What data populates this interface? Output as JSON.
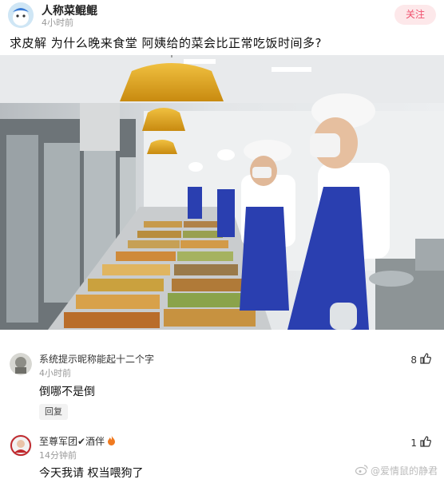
{
  "post": {
    "author": "人称菜鲲鲲",
    "time": "4小时前",
    "follow_label": "关注",
    "title": "求皮解 为什么晚来食堂 阿姨给的菜会比正常吃饭时间多?"
  },
  "comments": [
    {
      "name": "系统提示昵称能起十二个字",
      "time": "4小时前",
      "text": "倒哪不是倒",
      "likes": "8",
      "reply_label": "回复"
    },
    {
      "name": "至尊军团✔酒伴",
      "time": "14分钟前",
      "text": "今天我请  权当喂狗了",
      "likes": "1"
    }
  ],
  "watermark": "@爱情鼠的静君",
  "icons": {
    "like": "thumbs-up-icon",
    "fire": "fire-icon",
    "weibo": "weibo-icon"
  },
  "colors": {
    "accent": "#f0506e",
    "follow_bg": "#fde8ea",
    "apron": "#2a3fb0"
  }
}
